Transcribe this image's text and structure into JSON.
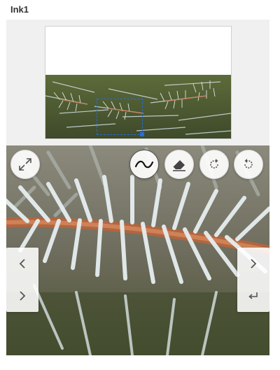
{
  "header": {
    "title": "Ink1"
  },
  "colors": {
    "selection": "#2a6cd8",
    "panel_bg": "#f0f0f0",
    "icon": "#555555"
  },
  "toolbar": {
    "buttons": [
      {
        "name": "expand-button",
        "icon": "expand-arrows-icon"
      },
      {
        "name": "pen-tool-button",
        "icon": "ink-squiggle-icon",
        "active": true
      },
      {
        "name": "eraser-button",
        "icon": "eraser-icon"
      },
      {
        "name": "redo-button",
        "icon": "redo-arrow-icon"
      },
      {
        "name": "undo-button",
        "icon": "undo-arrow-icon"
      }
    ]
  },
  "navigation": {
    "left": [
      {
        "icon": "chevron-left-icon"
      },
      {
        "icon": "chevron-right-icon"
      }
    ],
    "right": [
      {
        "icon": "chevron-right-icon"
      },
      {
        "icon": "enter-return-icon"
      }
    ]
  }
}
